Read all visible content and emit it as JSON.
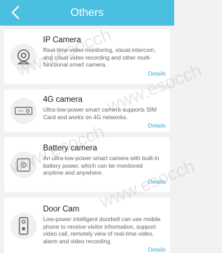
{
  "header": {
    "title": "Others"
  },
  "cards": [
    {
      "title": "IP Camera",
      "description": "Real-time video monitoring, visual intercom, and cloud video recording and other multi-functional smart camera.",
      "details": "Details",
      "icon": "ip-camera-icon"
    },
    {
      "title": "4G camera",
      "description": "Ultra-low-power smart camera supports SIM Card and works on 4G networks.",
      "details": "Details",
      "icon": "4g-camera-icon"
    },
    {
      "title": "Battery camera",
      "description": "An ultra-low-power smart camera with built-in battery power, which can be monitored anytime and anywhere.",
      "details": "Details",
      "icon": "battery-camera-icon"
    },
    {
      "title": "Door Cam",
      "description": "Low-power intelligent doorbell can use mobile phone to receive visitor information, support video call, remotely view of real-time video, alarm and video recording.",
      "details": "Details",
      "icon": "doorbell-icon"
    }
  ],
  "watermark": "www.esocch",
  "colors": {
    "header": "#4bbfe0",
    "link": "#3fa9d8"
  }
}
